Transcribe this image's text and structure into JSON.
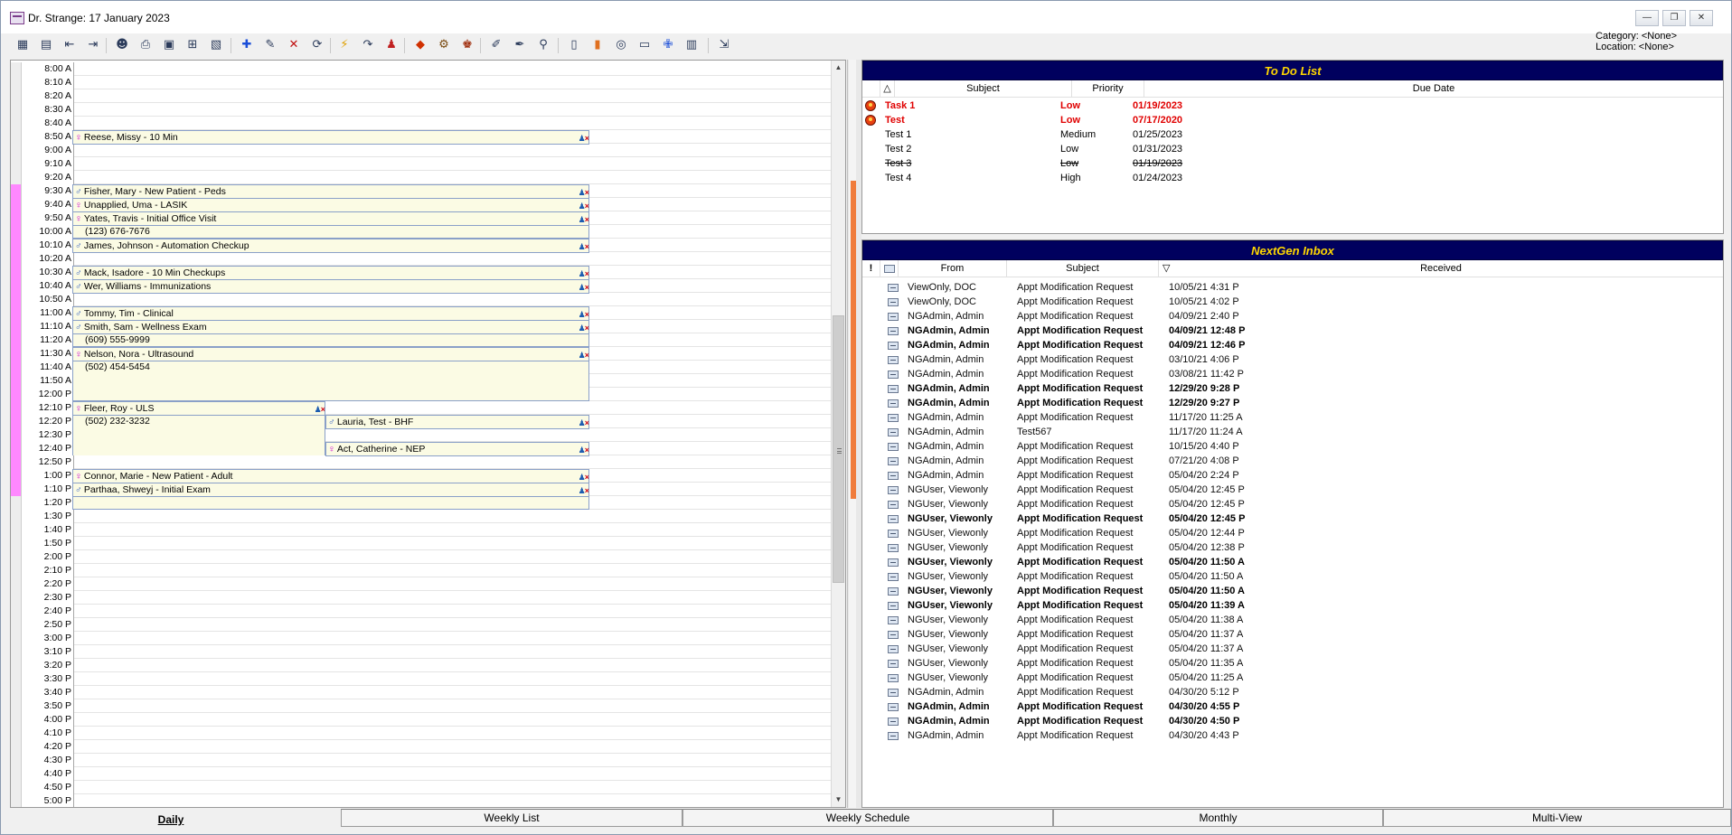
{
  "window": {
    "title": "Dr. Strange: 17 January 2023",
    "minimize": "—",
    "restore": "❐",
    "close": "✕"
  },
  "header": {
    "category": "Category: <None>",
    "location": "Location: <None>"
  },
  "toolbar": {
    "icons": [
      "day-view-icon",
      "week-view-icon",
      "prev-icon",
      "next-icon",
      "find-patient-icon",
      "print-icon",
      "resources-icon",
      "filter-icon",
      "calendar-icon",
      "add-appt-icon",
      "edit-appt-icon",
      "delete-appt-icon",
      "reschedule-icon",
      "quick-icon",
      "redo-icon",
      "checkin-icon",
      "arrive-icon",
      "provider-icon",
      "kiosk-icon",
      "tools-icon",
      "pen-icon",
      "lookup-icon",
      "notes-icon",
      "book-icon",
      "cycle-icon",
      "screen-icon",
      "medical-icon",
      "chart-icon",
      "exit-icon"
    ]
  },
  "schedule": {
    "times": [
      "8:00 A",
      "8:10 A",
      "8:20 A",
      "8:30 A",
      "8:40 A",
      "8:50 A",
      "9:00 A",
      "9:10 A",
      "9:20 A",
      "9:30 A",
      "9:40 A",
      "9:50 A",
      "10:00 A",
      "10:10 A",
      "10:20 A",
      "10:30 A",
      "10:40 A",
      "10:50 A",
      "11:00 A",
      "11:10 A",
      "11:20 A",
      "11:30 A",
      "11:40 A",
      "11:50 A",
      "12:00 P",
      "12:10 P",
      "12:20 P",
      "12:30 P",
      "12:40 P",
      "12:50 P",
      "1:00 P",
      "1:10 P",
      "1:20 P",
      "1:30 P",
      "1:40 P",
      "1:50 P",
      "2:00 P",
      "2:10 P",
      "2:20 P",
      "2:30 P",
      "2:40 P",
      "2:50 P",
      "3:00 P",
      "3:10 P",
      "3:20 P",
      "3:30 P",
      "3:40 P",
      "3:50 P",
      "4:00 P",
      "4:10 P",
      "4:20 P",
      "4:30 P",
      "4:40 P",
      "4:50 P",
      "5:00 P"
    ],
    "booked_slots": [
      9,
      10,
      11,
      12,
      13,
      14,
      15,
      16,
      17,
      18,
      19,
      20,
      21,
      22,
      23,
      24,
      25,
      26,
      27,
      28,
      29,
      30,
      31
    ],
    "appointments": [
      {
        "text": "Reese, Missy -  10 Min",
        "gender": "f",
        "slot": 5,
        "span": 1
      },
      {
        "text": "Fisher, Mary -  New Patient - Peds",
        "gender": "m",
        "slot": 9,
        "span": 1
      },
      {
        "text": "Unapplied, Uma -  LASIK",
        "gender": "f",
        "slot": 10,
        "span": 1
      },
      {
        "text": "Yates, Travis -  Initial Office Visit",
        "gender": "f",
        "slot": 11,
        "span": 2,
        "phone": "(123) 676-7676"
      },
      {
        "text": "James, Johnson -  Automation Checkup",
        "gender": "m",
        "slot": 13,
        "span": 1
      },
      {
        "text": "Mack, Isadore -  10 Min Checkups",
        "gender": "m",
        "slot": 15,
        "span": 1
      },
      {
        "text": "Wer, Williams -  Immunizations",
        "gender": "m",
        "slot": 16,
        "span": 1
      },
      {
        "text": "Tommy, Tim -  Clinical",
        "gender": "m",
        "slot": 18,
        "span": 1
      },
      {
        "text": "Smith, Sam -  Wellness Exam",
        "gender": "m",
        "slot": 19,
        "span": 2,
        "phone": "(609) 555-9999"
      },
      {
        "text": "Nelson, Nora -  Ultrasound",
        "gender": "f",
        "slot": 21,
        "span": 4,
        "phone": "(502) 454-5454"
      },
      {
        "text": "Fleer, Roy -  ULS",
        "gender": "f",
        "slot": 25,
        "span": 4,
        "phone": "(502) 232-3232",
        "half": "left"
      },
      {
        "text": "Lauria, Test -  BHF",
        "gender": "m",
        "slot": 26,
        "span": 1,
        "half": "right"
      },
      {
        "text": "Act, Catherine -  NEP",
        "gender": "f",
        "slot": 28,
        "span": 1,
        "half": "right"
      },
      {
        "text": "Connor, Marie -  New Patient - Adult",
        "gender": "f",
        "slot": 30,
        "span": 1
      },
      {
        "text": "Parthaa, Shweyj -  Initial Exam",
        "gender": "m",
        "slot": 31,
        "span": 2
      }
    ]
  },
  "todo": {
    "title": "To Do List",
    "columns": {
      "sort": "△",
      "subject": "Subject",
      "priority": "Priority",
      "due": "Due Date"
    },
    "rows": [
      {
        "subject": "Task 1",
        "priority": "Low",
        "due": "01/19/2023",
        "overdue": true
      },
      {
        "subject": "Test",
        "priority": "Low",
        "due": "07/17/2020",
        "overdue": true
      },
      {
        "subject": "Test 1",
        "priority": "Medium",
        "due": "01/25/2023"
      },
      {
        "subject": "Test 2",
        "priority": "Low",
        "due": "01/31/2023"
      },
      {
        "subject": "Test 3",
        "priority": "Low",
        "due": "01/19/2023",
        "done": true
      },
      {
        "subject": "Test 4",
        "priority": "High",
        "due": "01/24/2023"
      }
    ]
  },
  "inbox": {
    "title": "NextGen Inbox",
    "columns": {
      "flag": "!",
      "from": "From",
      "subject": "Subject",
      "sort": "▽",
      "received": "Received"
    },
    "rows": [
      {
        "from": "ViewOnly, DOC",
        "subject": "Appt Modification Request",
        "received": "10/05/21 4:31 P",
        "unread": false
      },
      {
        "from": "ViewOnly, DOC",
        "subject": "Appt Modification Request",
        "received": "10/05/21 4:02 P",
        "unread": false
      },
      {
        "from": "NGAdmin, Admin",
        "subject": "Appt Modification Request",
        "received": "04/09/21 2:40 P",
        "unread": false
      },
      {
        "from": "NGAdmin, Admin",
        "subject": "Appt Modification Request",
        "received": "04/09/21 12:48 P",
        "unread": true
      },
      {
        "from": "NGAdmin, Admin",
        "subject": "Appt Modification Request",
        "received": "04/09/21 12:46 P",
        "unread": true
      },
      {
        "from": "NGAdmin, Admin",
        "subject": "Appt Modification Request",
        "received": "03/10/21 4:06 P",
        "unread": false
      },
      {
        "from": "NGAdmin, Admin",
        "subject": "Appt Modification Request",
        "received": "03/08/21 11:42 P",
        "unread": false
      },
      {
        "from": "NGAdmin, Admin",
        "subject": "Appt Modification Request",
        "received": "12/29/20 9:28 P",
        "unread": true
      },
      {
        "from": "NGAdmin, Admin",
        "subject": "Appt Modification Request",
        "received": "12/29/20 9:27 P",
        "unread": true
      },
      {
        "from": "NGAdmin, Admin",
        "subject": "Appt Modification Request",
        "received": "11/17/20 11:25 A",
        "unread": false
      },
      {
        "from": "NGAdmin, Admin",
        "subject": "Test567",
        "received": "11/17/20 11:24 A",
        "unread": false
      },
      {
        "from": "NGAdmin, Admin",
        "subject": "Appt Modification Request",
        "received": "10/15/20 4:40 P",
        "unread": false
      },
      {
        "from": "NGAdmin, Admin",
        "subject": "Appt Modification Request",
        "received": "07/21/20 4:08 P",
        "unread": false
      },
      {
        "from": "NGAdmin, Admin",
        "subject": "Appt Modification Request",
        "received": "05/04/20 2:24 P",
        "unread": false
      },
      {
        "from": "NGUser, Viewonly",
        "subject": "Appt Modification Request",
        "received": "05/04/20 12:45 P",
        "unread": false
      },
      {
        "from": "NGUser, Viewonly",
        "subject": "Appt Modification Request",
        "received": "05/04/20 12:45 P",
        "unread": false
      },
      {
        "from": "NGUser, Viewonly",
        "subject": "Appt Modification Request",
        "received": "05/04/20 12:45 P",
        "unread": true
      },
      {
        "from": "NGUser, Viewonly",
        "subject": "Appt Modification Request",
        "received": "05/04/20 12:44 P",
        "unread": false
      },
      {
        "from": "NGUser, Viewonly",
        "subject": "Appt Modification Request",
        "received": "05/04/20 12:38 P",
        "unread": false
      },
      {
        "from": "NGUser, Viewonly",
        "subject": "Appt Modification Request",
        "received": "05/04/20 11:50 A",
        "unread": true
      },
      {
        "from": "NGUser, Viewonly",
        "subject": "Appt Modification Request",
        "received": "05/04/20 11:50 A",
        "unread": false
      },
      {
        "from": "NGUser, Viewonly",
        "subject": "Appt Modification Request",
        "received": "05/04/20 11:50 A",
        "unread": true
      },
      {
        "from": "NGUser, Viewonly",
        "subject": "Appt Modification Request",
        "received": "05/04/20 11:39 A",
        "unread": true
      },
      {
        "from": "NGUser, Viewonly",
        "subject": "Appt Modification Request",
        "received": "05/04/20 11:38 A",
        "unread": false
      },
      {
        "from": "NGUser, Viewonly",
        "subject": "Appt Modification Request",
        "received": "05/04/20 11:37 A",
        "unread": false
      },
      {
        "from": "NGUser, Viewonly",
        "subject": "Appt Modification Request",
        "received": "05/04/20 11:37 A",
        "unread": false
      },
      {
        "from": "NGUser, Viewonly",
        "subject": "Appt Modification Request",
        "received": "05/04/20 11:35 A",
        "unread": false
      },
      {
        "from": "NGUser, Viewonly",
        "subject": "Appt Modification Request",
        "received": "05/04/20 11:25 A",
        "unread": false
      },
      {
        "from": "NGAdmin, Admin",
        "subject": "Appt Modification Request",
        "received": "04/30/20 5:12 P",
        "unread": false
      },
      {
        "from": "NGAdmin, Admin",
        "subject": "Appt Modification Request",
        "received": "04/30/20 4:55 P",
        "unread": true
      },
      {
        "from": "NGAdmin, Admin",
        "subject": "Appt Modification Request",
        "received": "04/30/20 4:50 P",
        "unread": true
      },
      {
        "from": "NGAdmin, Admin",
        "subject": "Appt Modification Request",
        "received": "04/30/20 4:43 P",
        "unread": false
      }
    ]
  },
  "tabs": [
    "Daily",
    "Weekly List",
    "Weekly Schedule",
    "Monthly",
    "Multi-View"
  ],
  "active_tab": "Daily",
  "colors": {
    "booked": "#ff88ff",
    "header_bg": "#00005e",
    "header_fg": "#ffd700",
    "overdue": "#e00000",
    "accent_splitter": "#f07c3c"
  }
}
